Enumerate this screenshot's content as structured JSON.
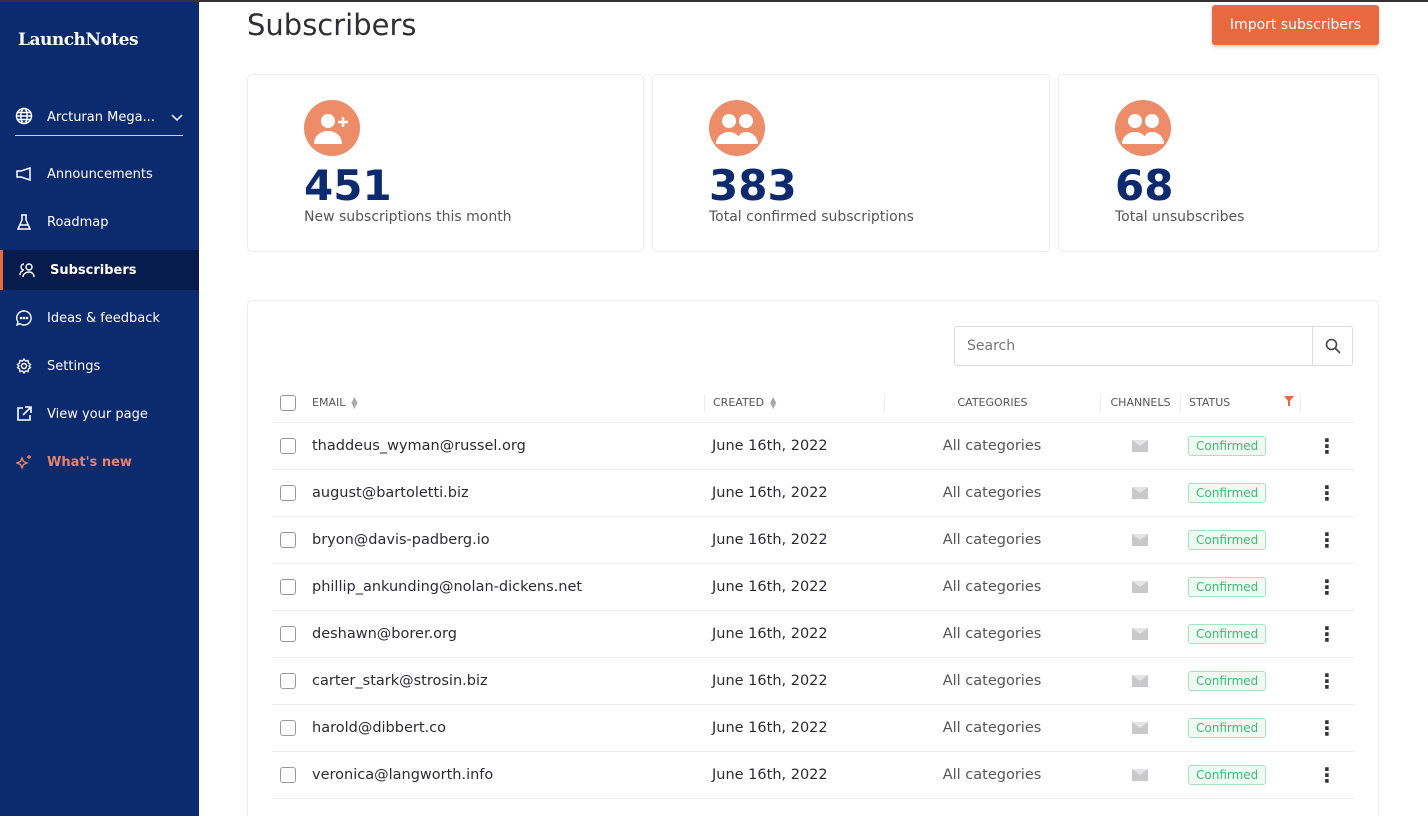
{
  "sidebar": {
    "logo": "LaunchNotes",
    "org": "Arcturan Mega...",
    "items": [
      {
        "label": "Announcements"
      },
      {
        "label": "Roadmap"
      },
      {
        "label": "Subscribers"
      },
      {
        "label": "Ideas & feedback"
      },
      {
        "label": "Settings"
      },
      {
        "label": "View your page"
      },
      {
        "label": "What's new"
      }
    ]
  },
  "header": {
    "title": "Subscribers",
    "import_label": "Import subscribers"
  },
  "stats": [
    {
      "value": "451",
      "label": "New subscriptions this month",
      "icon": "user-plus-icon"
    },
    {
      "value": "383",
      "label": "Total confirmed subscriptions",
      "icon": "users-icon"
    },
    {
      "value": "68",
      "label": "Total unsubscribes",
      "icon": "users-icon"
    }
  ],
  "table": {
    "search_placeholder": "Search",
    "headers": {
      "email": "EMAIL",
      "created": "CREATED",
      "categories": "CATEGORIES",
      "channels": "CHANNELS",
      "status": "STATUS"
    },
    "rows": [
      {
        "email": "thaddeus_wyman@russel.org",
        "created": "June 16th, 2022",
        "categories": "All categories",
        "status": "Confirmed"
      },
      {
        "email": "august@bartoletti.biz",
        "created": "June 16th, 2022",
        "categories": "All categories",
        "status": "Confirmed"
      },
      {
        "email": "bryon@davis-padberg.io",
        "created": "June 16th, 2022",
        "categories": "All categories",
        "status": "Confirmed"
      },
      {
        "email": "phillip_ankunding@nolan-dickens.net",
        "created": "June 16th, 2022",
        "categories": "All categories",
        "status": "Confirmed"
      },
      {
        "email": "deshawn@borer.org",
        "created": "June 16th, 2022",
        "categories": "All categories",
        "status": "Confirmed"
      },
      {
        "email": "carter_stark@strosin.biz",
        "created": "June 16th, 2022",
        "categories": "All categories",
        "status": "Confirmed"
      },
      {
        "email": "harold@dibbert.co",
        "created": "June 16th, 2022",
        "categories": "All categories",
        "status": "Confirmed"
      },
      {
        "email": "veronica@langworth.info",
        "created": "June 16th, 2022",
        "categories": "All categories",
        "status": "Confirmed"
      }
    ]
  },
  "colors": {
    "sidebar": "#0c2a6e",
    "accent": "#e8693f",
    "confirmed": "#3fb876"
  }
}
